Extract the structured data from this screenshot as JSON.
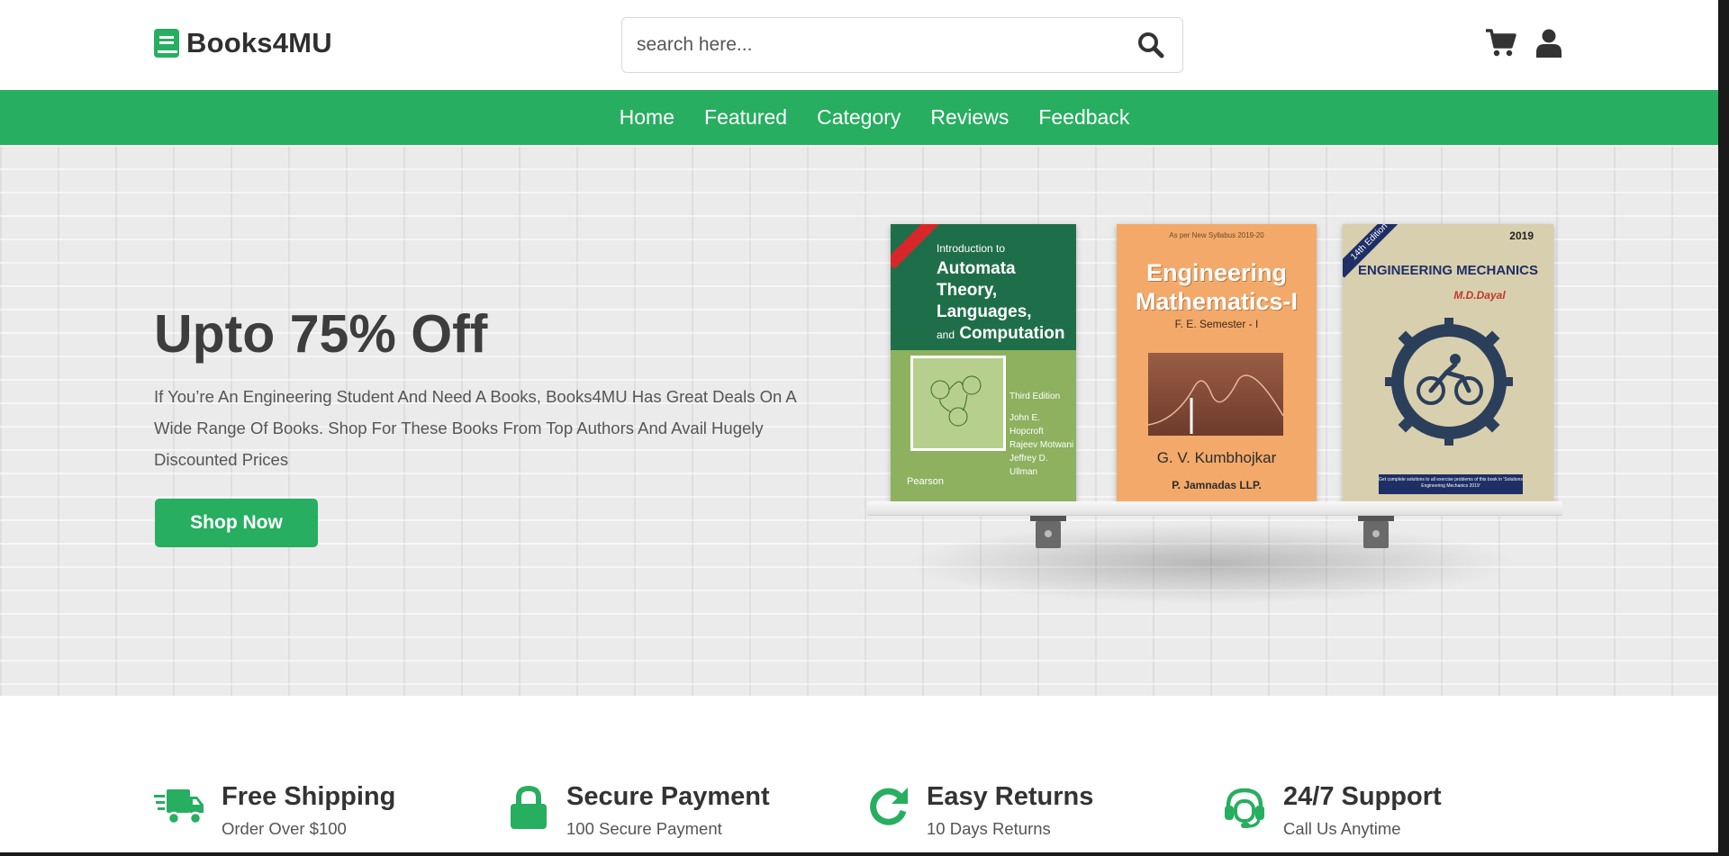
{
  "brand": {
    "name": "Books4MU",
    "accent": "#27ae60"
  },
  "search": {
    "placeholder": "search here..."
  },
  "header_icons": [
    {
      "name": "shopping-cart-icon"
    },
    {
      "name": "user-icon"
    }
  ],
  "nav": {
    "items": [
      {
        "label": "Home"
      },
      {
        "label": "Featured"
      },
      {
        "label": "Category"
      },
      {
        "label": "Reviews"
      },
      {
        "label": "Feedback"
      }
    ]
  },
  "hero": {
    "title": "Upto 75% Off",
    "text": "If You’re An Engineering Student And Need A Books, Books4MU Has Great Deals On A Wide Range Of Books. Shop For These Books From Top Authors And Avail Hugely Discounted Prices",
    "button": "Shop Now"
  },
  "books": [
    {
      "intro": "Introduction to",
      "title_lines": [
        "Automata",
        "Theory,",
        "Languages,"
      ],
      "and": "and",
      "last": "Computation",
      "edition": "Third Edition",
      "authors": [
        "John E. Hopcroft",
        "Rajeev Motwani",
        "Jeffrey D. Ullman"
      ],
      "publisher": "Pearson"
    },
    {
      "syllabus": "As per New Syllabus 2019-20",
      "title_lines": [
        "Engineering",
        "Mathematics-I"
      ],
      "semester": "F. E. Semester - I",
      "author": "G. V. Kumbhojkar",
      "publisher": "P. Jamnadas LLP."
    },
    {
      "year": "2019",
      "edition": "14th Edition",
      "title": "ENGINEERING MECHANICS",
      "author": "M.D.Dayal",
      "note": "Get complete solutions to all exercise problems of this book in 'Solutions Engineering Mechanics 2019'"
    }
  ],
  "features": [
    {
      "icon": "truck-icon",
      "title": "Free Shipping",
      "subtitle": "Order Over $100"
    },
    {
      "icon": "lock-icon",
      "title": "Secure Payment",
      "subtitle": "100 Secure Payment"
    },
    {
      "icon": "redo-icon",
      "title": "Easy Returns",
      "subtitle": "10 Days Returns"
    },
    {
      "icon": "headset-icon",
      "title": "24/7 Support",
      "subtitle": "Call Us Anytime"
    }
  ]
}
